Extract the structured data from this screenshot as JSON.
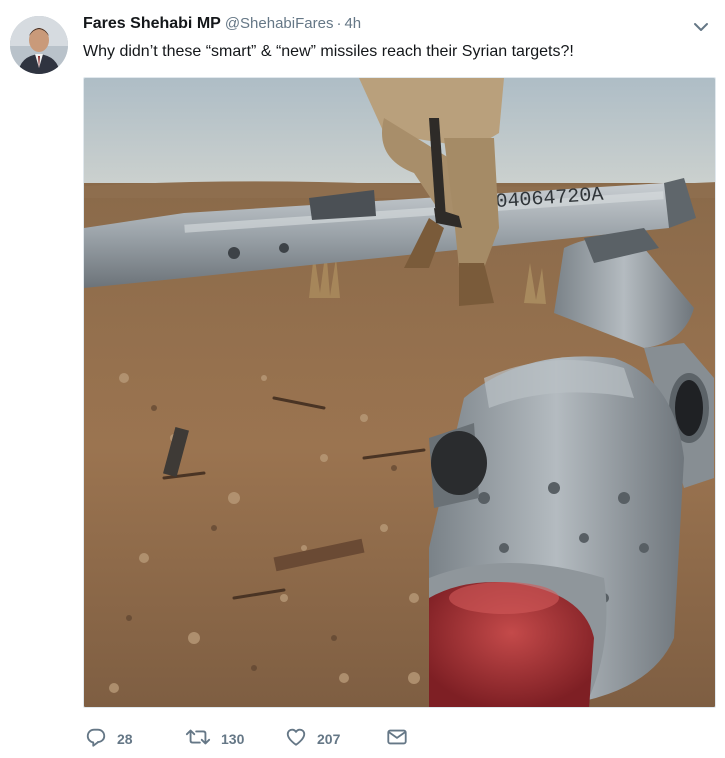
{
  "tweet": {
    "display_name": "Fares Shehabi MP",
    "handle": "@ShehabiFares",
    "separator": "·",
    "timestamp": "4h",
    "text": "Why didn’t these “smart” & “new” missiles reach their Syrian targets?!",
    "media": {
      "serial_number": "004064720A"
    },
    "actions": {
      "reply_count": "28",
      "retweet_count": "130",
      "like_count": "207"
    }
  },
  "icons": {
    "caret": "chevron-down-icon",
    "reply": "reply-icon",
    "retweet": "retweet-icon",
    "like": "heart-icon",
    "dm": "envelope-icon"
  },
  "colors": {
    "text_primary": "#14171a",
    "text_secondary": "#657786"
  }
}
